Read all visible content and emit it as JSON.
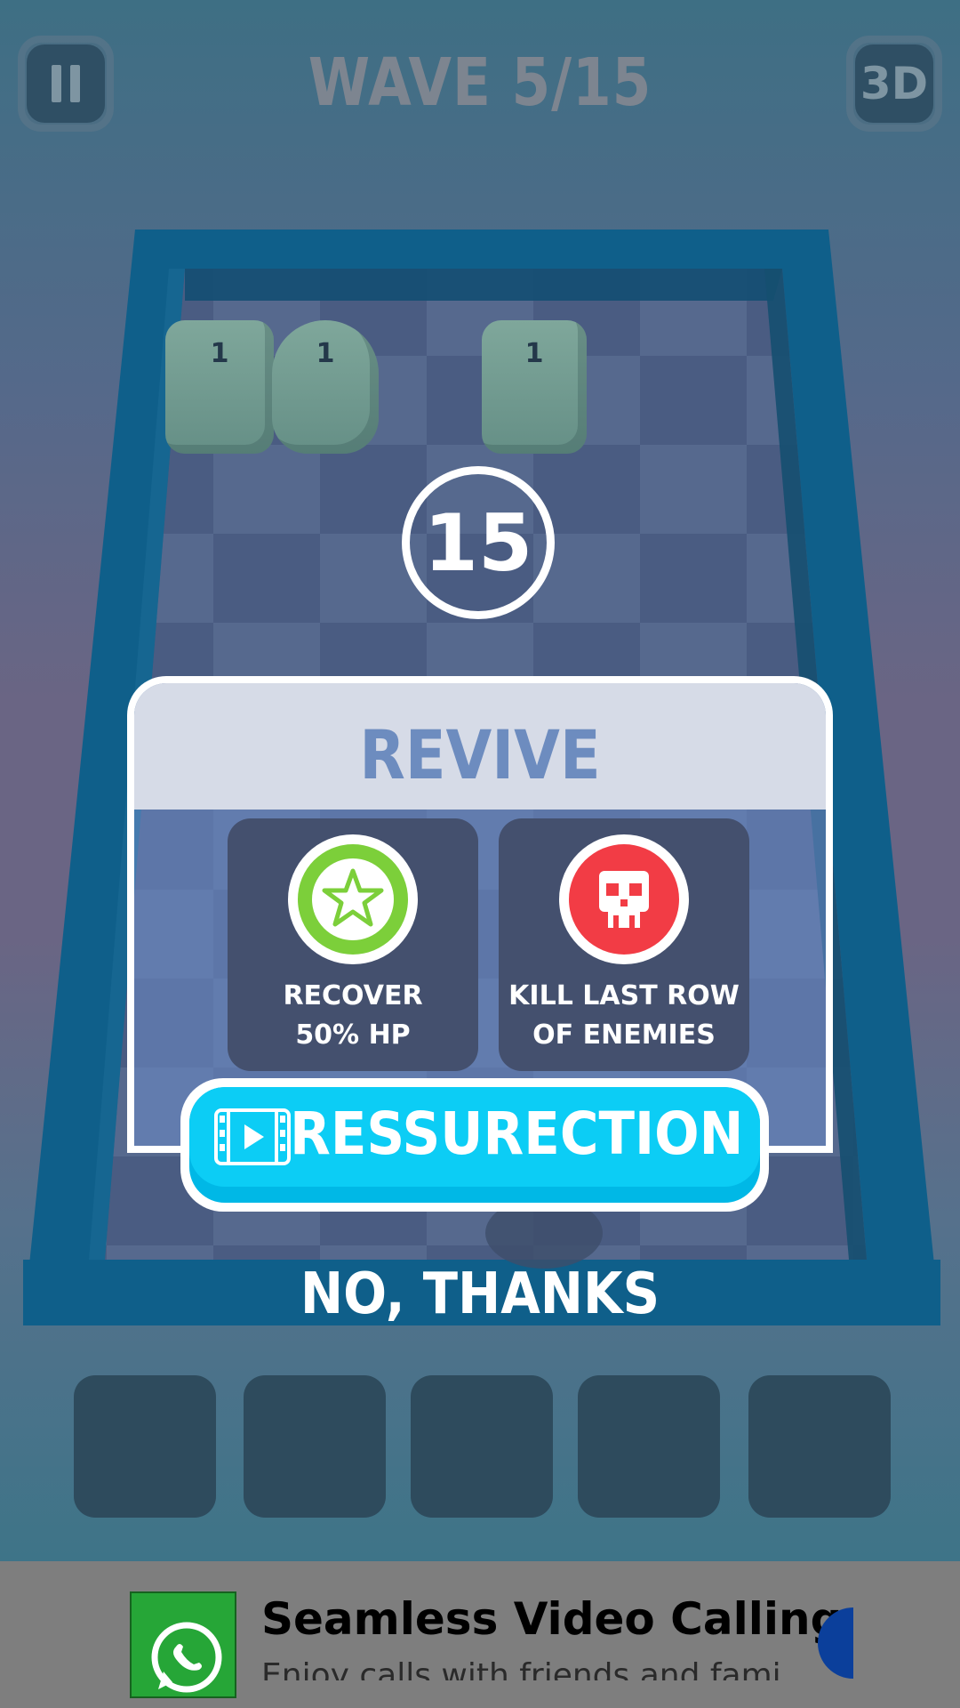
{
  "hud": {
    "wave_text": "WAVE 5/15",
    "view_toggle_label": "3D",
    "pause_icon": "pause-icon"
  },
  "board": {
    "enemies": [
      {
        "hp": "1",
        "shape": "cube"
      },
      {
        "hp": "1",
        "shape": "cylinder"
      },
      {
        "hp": "1",
        "shape": "cube"
      }
    ],
    "countdown": "15"
  },
  "revive_dialog": {
    "title": "REVIVE",
    "options": [
      {
        "icon": "star-icon",
        "line1": "RECOVER",
        "line2": "50% HP",
        "badge_color": "#7ccf3a"
      },
      {
        "icon": "skull-icon",
        "line1": "KILL LAST ROW",
        "line2": "OF ENEMIES",
        "badge_color": "#f23c45"
      }
    ],
    "resurrection_label": "RESSURECTION",
    "resurrection_icon": "video-film-icon",
    "decline_label": "NO, THANKS"
  },
  "inventory": {
    "slot_count": 5
  },
  "ad_banner": {
    "icon": "whatsapp-icon",
    "title": "Seamless Video Calling",
    "subtitle": "Enjoy calls with friends and fami"
  },
  "colors": {
    "accent_cyan": "#0ccdf5",
    "board_frame": "#0f5f8a"
  }
}
